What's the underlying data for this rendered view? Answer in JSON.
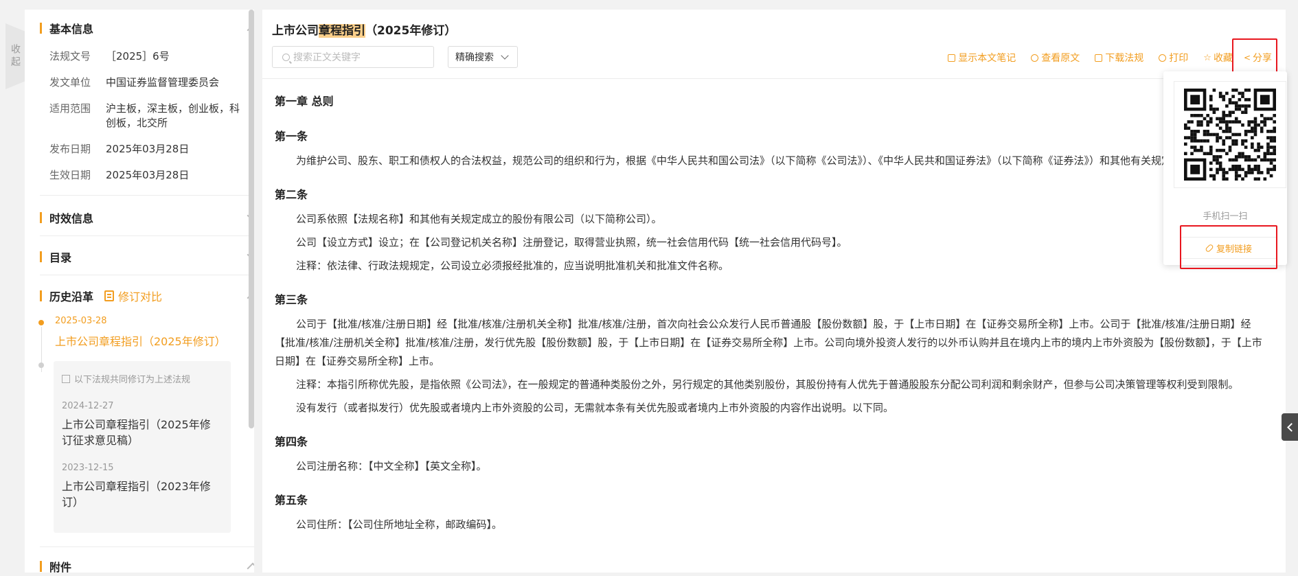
{
  "collapse_label": "收起",
  "basic_info": {
    "title": "基本信息",
    "rows": [
      {
        "label": "法规文号",
        "value": "［2025］6号"
      },
      {
        "label": "发文单位",
        "value": "中国证券监督管理委员会"
      },
      {
        "label": "适用范围",
        "value": "沪主板，深主板，创业板，科创板，北交所"
      },
      {
        "label": "发布日期",
        "value": "2025年03月28日"
      },
      {
        "label": "生效日期",
        "value": "2025年03月28日"
      }
    ]
  },
  "validity": {
    "title": "时效信息"
  },
  "toc": {
    "title": "目录"
  },
  "history": {
    "title": "历史沿革",
    "compare_label": "修订对比",
    "current": {
      "date": "2025-03-28",
      "title": "上市公司章程指引（2025年修订）"
    },
    "note": "以下法规共同修订为上述法规",
    "items": [
      {
        "date": "2024-12-27",
        "title": "上市公司章程指引（2025年修订征求意见稿）"
      },
      {
        "date": "2023-12-15",
        "title": "上市公司章程指引（2023年修订）"
      }
    ]
  },
  "attachment": {
    "title": "附件"
  },
  "doc": {
    "title_pre": "上市公司",
    "title_hl": "章程指引",
    "title_post": "（2025年修订）",
    "search_placeholder": "搜索正文关键字",
    "search_mode": "精确搜索",
    "tools": {
      "notes": "显示本文笔记",
      "original": "查看原文",
      "download": "下载法规",
      "print": "打印",
      "favorite": "收藏",
      "share": "分享"
    },
    "chapter": "第一章 总则",
    "articles": [
      {
        "title": "第一条",
        "paras": [
          "为维护公司、股东、职工和债权人的合法权益，规范公司的组织和行为，根据《中华人民共和国公司法》（以下简称《公司法》）、《中华人民共和国证券法》（以下简称《证券法》）和其他有关规定，制定本章程。"
        ]
      },
      {
        "title": "第二条",
        "paras": [
          "公司系依照【法规名称】和其他有关规定成立的股份有限公司（以下简称公司）。",
          "公司【设立方式】设立；在【公司登记机关名称】注册登记，取得营业执照，统一社会信用代码【统一社会信用代码号】。",
          "注释：依法律、行政法规规定，公司设立必须报经批准的，应当说明批准机关和批准文件名称。"
        ]
      },
      {
        "title": "第三条",
        "paras": [
          "公司于【批准/核准/注册日期】经【批准/核准/注册机关全称】批准/核准/注册，首次向社会公众发行人民币普通股【股份数额】股，于【上市日期】在【证券交易所全称】上市。公司于【批准/核准/注册日期】经【批准/核准/注册机关全称】批准/核准/注册，发行优先股【股份数额】股，于【上市日期】在【证券交易所全称】上市。公司向境外投资人发行的以外币认购并且在境内上市的境内上市外资股为【股份数额】，于【上市日期】在【证券交易所全称】上市。",
          "注释：本指引所称优先股，是指依照《公司法》，在一般规定的普通种类股份之外，另行规定的其他类别股份，其股份持有人优先于普通股股东分配公司利润和剩余财产，但参与公司决策管理等权利受到限制。",
          "没有发行（或者拟发行）优先股或者境内上市外资股的公司，无需就本条有关优先股或者境内上市外资股的内容作出说明。以下同。"
        ]
      },
      {
        "title": "第四条",
        "paras": [
          "公司注册名称：【中文全称】【英文全称】。"
        ]
      },
      {
        "title": "第五条",
        "paras": [
          "公司住所：【公司住所地址全称，邮政编码】。"
        ]
      }
    ]
  },
  "share_popup": {
    "scan_text": "手机扫一扫",
    "copy_link": "复制链接"
  },
  "colors": {
    "accent": "#f29d1f",
    "highlight": "#fbcf8a",
    "annotation_red": "#e8161e"
  }
}
